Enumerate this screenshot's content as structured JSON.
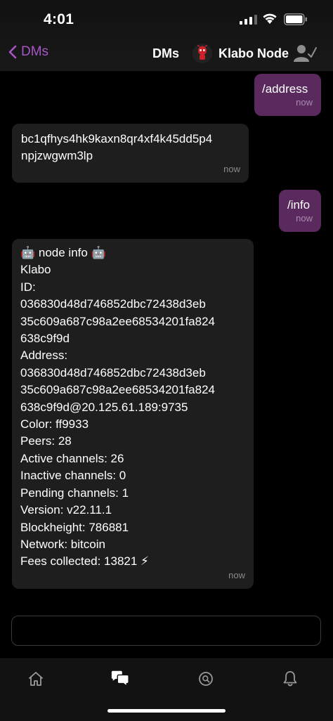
{
  "status": {
    "time": "4:01"
  },
  "nav": {
    "back_label": "DMs",
    "title": "DMs",
    "contact_name": "Klabo Node"
  },
  "messages": [
    {
      "direction": "out",
      "text": "/address",
      "time": "now"
    },
    {
      "direction": "in",
      "text": "bc1qfhys4hk9kaxn8qr4xf4k45dd5p4\nnpjzwgwm3lp",
      "time": "now"
    },
    {
      "direction": "out",
      "text": "/info",
      "time": "now"
    },
    {
      "direction": "in",
      "text": "🤖 node info 🤖\nKlabo\nID:\n036830d48d746852dbc72438d3eb\n35c609a687c98a2ee68534201fa824\n638c9f9d\nAddress:\n036830d48d746852dbc72438d3eb\n35c609a687c98a2ee68534201fa824\n638c9f9d@20.125.61.189:9735\nColor: ff9933\nPeers: 28\nActive channels: 26\nInactive channels: 0\nPending channels: 1\nVersion: v22.11.1\nBlockheight: 786881\nNetwork: bitcoin\nFees collected: 13821 ⚡",
      "time": "now"
    }
  ],
  "composer": {
    "value": "",
    "placeholder": ""
  },
  "colors": {
    "accent": "#a855c7",
    "outgoing_bubble": "#5a2a5e",
    "incoming_bubble": "#1e1e1e"
  },
  "tabs": [
    {
      "icon": "home-icon",
      "active": false
    },
    {
      "icon": "chat-bubbles-icon",
      "active": true
    },
    {
      "icon": "search-icon",
      "active": false
    },
    {
      "icon": "bell-icon",
      "active": false
    }
  ]
}
